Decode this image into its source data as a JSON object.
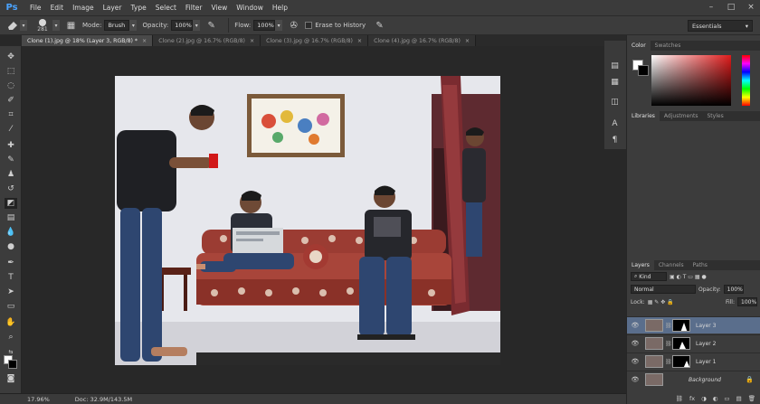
{
  "app": {
    "logo": "Ps"
  },
  "menu": [
    "File",
    "Edit",
    "Image",
    "Layer",
    "Type",
    "Select",
    "Filter",
    "View",
    "Window",
    "Help"
  ],
  "window_controls": [
    "–",
    "□",
    "×"
  ],
  "options": {
    "brush_size": "281",
    "mode_label": "Mode:",
    "mode_value": "Brush",
    "opacity_label": "Opacity:",
    "opacity_value": "100%",
    "flow_label": "Flow:",
    "flow_value": "100%",
    "erase_history_label": "Erase to History",
    "workspace": "Essentials"
  },
  "tabs": [
    {
      "label": "Clone (1).jpg @ 18% (Layer 3, RGB/8) *",
      "active": true
    },
    {
      "label": "Clone (2).jpg @ 16.7% (RGB/8)",
      "active": false
    },
    {
      "label": "Clone (3).jpg @ 16.7% (RGB/8)",
      "active": false
    },
    {
      "label": "Clone (4).jpg @ 16.7% (RGB/8)",
      "active": false
    }
  ],
  "status": {
    "zoom": "17.96%",
    "doc": "Doc: 32.9M/143.5M"
  },
  "panels": {
    "color_tabs": [
      "Color",
      "Swatches"
    ],
    "library_tabs": [
      "Libraries",
      "Adjustments",
      "Styles"
    ],
    "layer_tabs": [
      "Layers",
      "Channels",
      "Paths"
    ],
    "kind_label": "Kind",
    "blend_mode": "Normal",
    "opacity_label": "Opacity:",
    "opacity_value": "100%",
    "lock_label": "Lock:",
    "fill_label": "Fill:",
    "fill_value": "100%",
    "footer_icons": [
      "⛓",
      "fx",
      "◑",
      "◐",
      "▭",
      "▤",
      "🗑"
    ]
  },
  "layers": [
    {
      "name": "Layer 3",
      "selected": true,
      "mask": true
    },
    {
      "name": "Layer 2",
      "selected": false,
      "mask": true
    },
    {
      "name": "Layer 1",
      "selected": false,
      "mask": true
    },
    {
      "name": "Background",
      "selected": false,
      "mask": false,
      "locked": true
    }
  ],
  "colors": {
    "accent_selected": "#5a6e8c",
    "panel": "#3c3c3c",
    "canvas_bg": "#282828"
  }
}
